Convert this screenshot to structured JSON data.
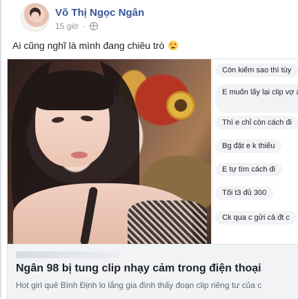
{
  "post": {
    "author": "Võ Thị Ngọc Ngân",
    "time": "15 giờ",
    "separator": "·",
    "caption": "Ai cũng nghĩ là mình đang chiêu trò",
    "emoji": "sad-face-emoji"
  },
  "comments": [
    "Còn kiếm sao thì tùy",
    "E muốn lấy lại clip vợ ảnh",
    "Thì e chỉ còn cách đi",
    "Bg đặt e k thiếu",
    "E tự tìm cách đi",
    "Tối t3 đủ 300",
    "Ck qua c gửi cả đt c"
  ],
  "link_preview": {
    "headline": "Ngân 98 bị tung clip nhạy cảm trong điện thoại",
    "description": "Hot girl quê Bình Định lo lắng gia đình thấy đoạn clip riêng tư của c"
  },
  "colors": {
    "author": "#385898",
    "text": "#1d2129",
    "meta": "#90949c",
    "card_bg": "#f2f3f5"
  }
}
